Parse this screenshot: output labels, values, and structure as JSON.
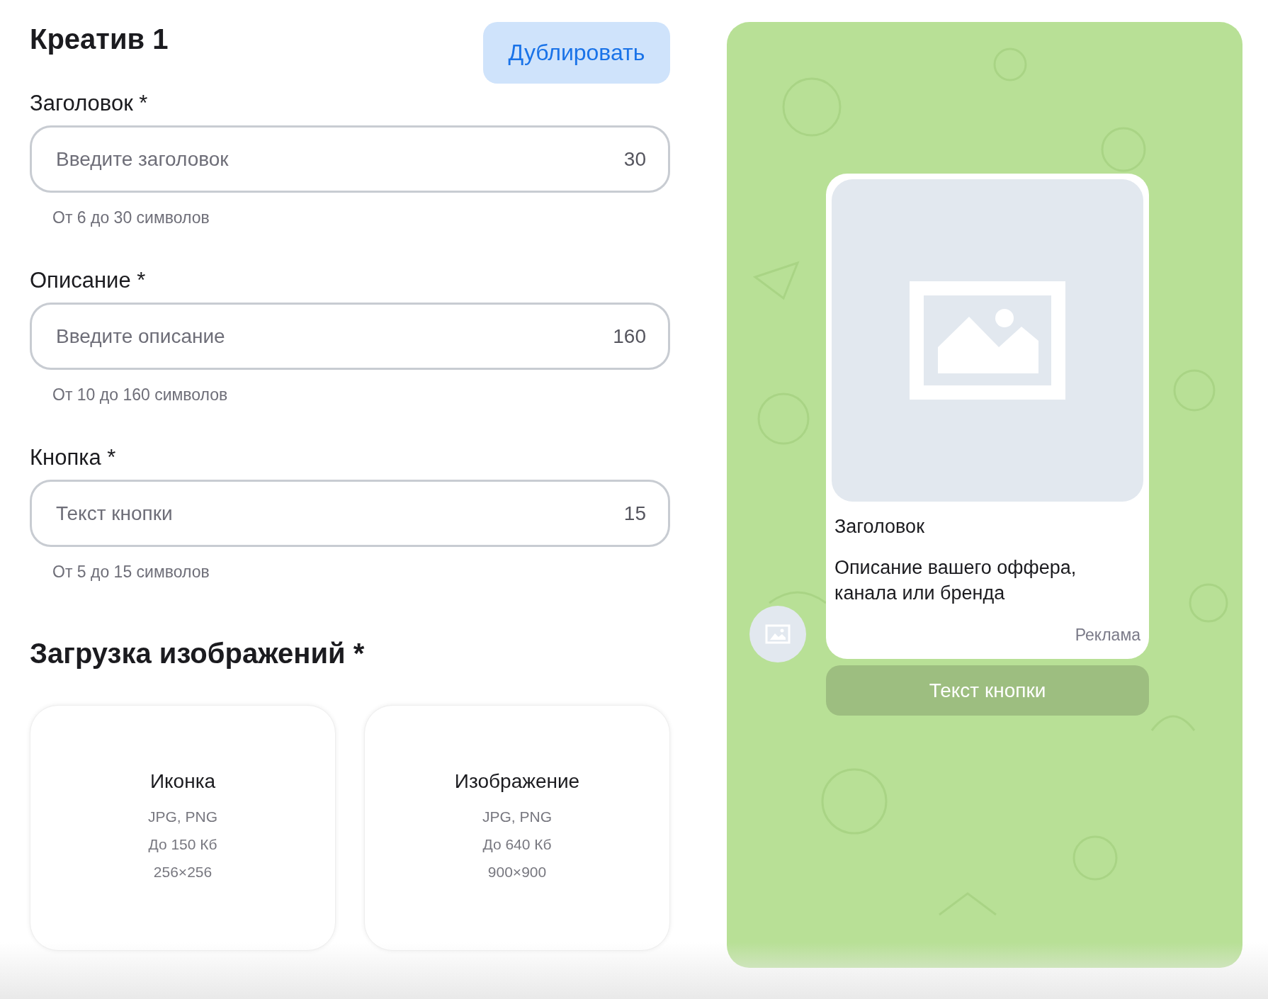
{
  "header": {
    "title": "Креатив 1",
    "duplicate_button": "Дублировать"
  },
  "fields": [
    {
      "label": "Заголовок *",
      "placeholder": "Введите заголовок",
      "counter": "30",
      "hint": "От 6 до 30 символов"
    },
    {
      "label": "Описание *",
      "placeholder": "Введите описание",
      "counter": "160",
      "hint": "От 10 до 160 символов"
    },
    {
      "label": "Кнопка *",
      "placeholder": "Текст кнопки",
      "counter": "15",
      "hint": "От 5 до 15 символов"
    }
  ],
  "upload": {
    "title": "Загрузка изображений *",
    "cards": [
      {
        "title": "Иконка",
        "lines": [
          "JPG, PNG",
          "До 150 Кб",
          "256×256"
        ]
      },
      {
        "title": "Изображение",
        "lines": [
          "JPG, PNG",
          "До 640 Кб",
          "900×900"
        ]
      }
    ]
  },
  "preview": {
    "title": "Заголовок",
    "description": "Описание вашего оффера, канала или бренда",
    "ad_label": "Реклама",
    "button": "Текст кнопки"
  }
}
